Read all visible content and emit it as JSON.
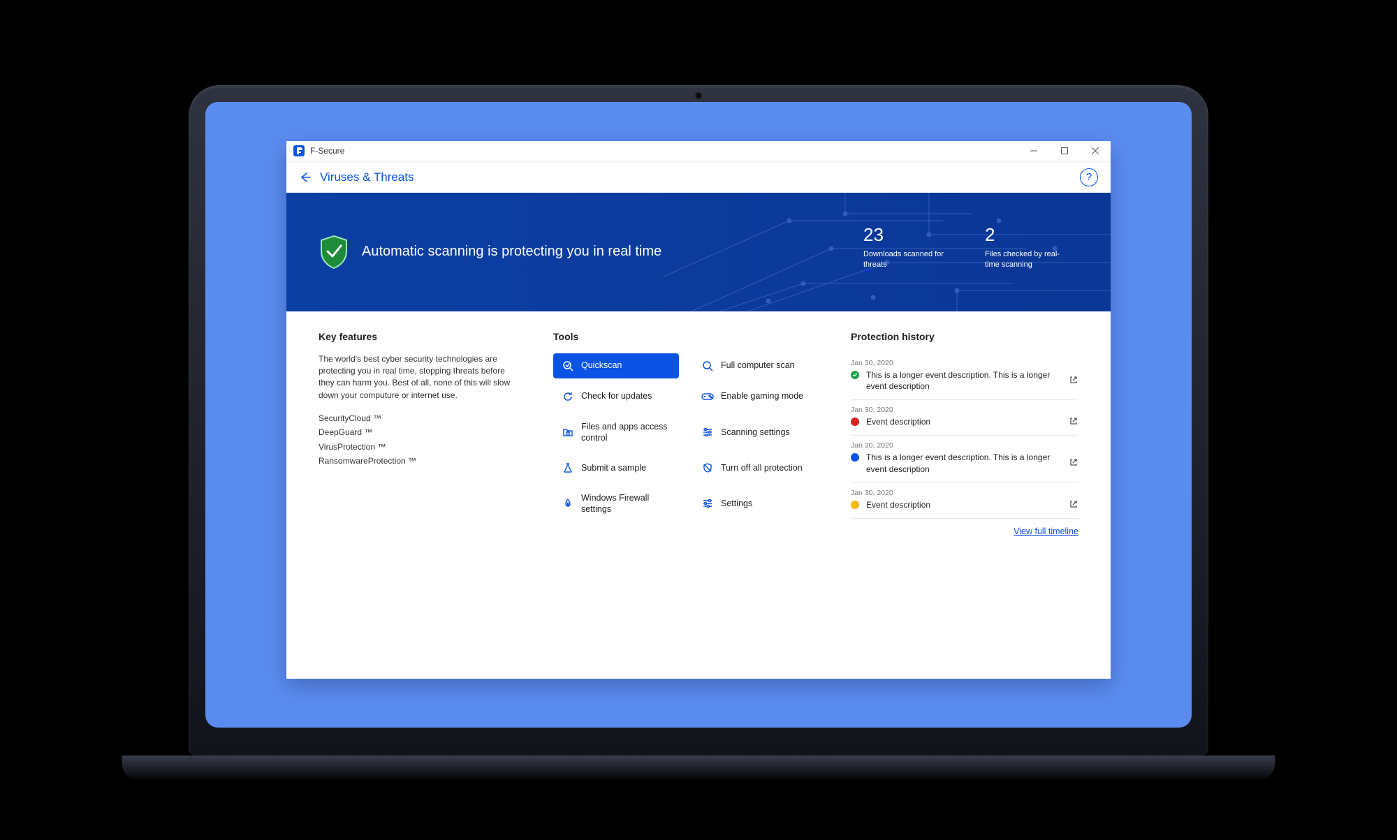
{
  "app_name": "F-Secure",
  "page_title": "Viruses & Threats",
  "hero": {
    "headline": "Automatic scanning is protecting you in real time",
    "stats": [
      {
        "value": "23",
        "label": "Downloads scanned for threats"
      },
      {
        "value": "2",
        "label": "Files checked by real-time scanning"
      }
    ]
  },
  "key_features": {
    "heading": "Key features",
    "description": "The world's best cyber security technologies are protecting you in real time, stopping threats before they can harm you. Best of all, none of this will slow down your computure or internet use.",
    "items": [
      "SecurityCloud ™",
      "DeepGuard ™",
      "VirusProtection ™",
      "RansomwareProtection ™"
    ]
  },
  "tools": {
    "heading": "Tools",
    "items": [
      {
        "id": "quickscan",
        "label": "Quickscan",
        "primary": true
      },
      {
        "id": "full-scan",
        "label": "Full computer scan",
        "primary": false
      },
      {
        "id": "check-updates",
        "label": "Check for updates",
        "primary": false
      },
      {
        "id": "gaming-mode",
        "label": "Enable gaming mode",
        "primary": false
      },
      {
        "id": "files-access",
        "label": "Files and apps access control",
        "primary": false
      },
      {
        "id": "scan-settings",
        "label": "Scanning settings",
        "primary": false
      },
      {
        "id": "submit-sample",
        "label": "Submit a sample",
        "primary": false
      },
      {
        "id": "turn-off",
        "label": "Turn off all protection",
        "primary": false
      },
      {
        "id": "firewall",
        "label": "Windows Firewall settings",
        "primary": false
      },
      {
        "id": "settings",
        "label": "Settings",
        "primary": false
      }
    ]
  },
  "history": {
    "heading": "Protection history",
    "view_full_label": "View full timeline",
    "events": [
      {
        "date": "Jan 30, 2020",
        "status": "green",
        "description": "This is a longer event description. This is a longer event description"
      },
      {
        "date": "Jan 30, 2020",
        "status": "red",
        "description": "Event description"
      },
      {
        "date": "Jan 30, 2020",
        "status": "blue",
        "description": "This is a longer event description. This is a longer event description"
      },
      {
        "date": "Jan 30, 2020",
        "status": "yellow",
        "description": "Event description"
      }
    ]
  },
  "help_glyph": "?"
}
